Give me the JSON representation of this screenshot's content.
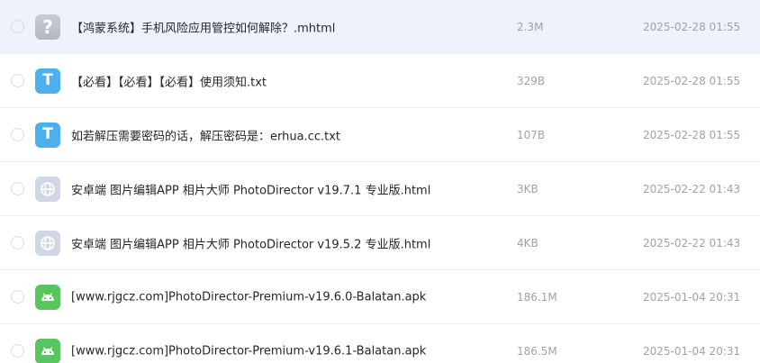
{
  "files": [
    {
      "icon": "unknown-file-icon",
      "type": "unknown",
      "glyph": "?",
      "name": "【鸿蒙系统】手机风险应用管控如何解除？.mhtml",
      "size": "2.3M",
      "date": "2025-02-28 01:55",
      "selected": true
    },
    {
      "icon": "text-file-icon",
      "type": "txt",
      "glyph": "T",
      "name": "【必看】【必看】【必看】使用须知.txt",
      "size": "329B",
      "date": "2025-02-28 01:55",
      "selected": false
    },
    {
      "icon": "text-file-icon",
      "type": "txt",
      "glyph": "T",
      "name": "如若解压需要密码的话，解压密码是：erhua.cc.txt",
      "size": "107B",
      "date": "2025-02-28 01:55",
      "selected": false
    },
    {
      "icon": "globe-icon",
      "type": "html",
      "glyph": "",
      "name": "安卓端 图片编辑APP 相片大师 PhotoDirector v19.7.1 专业版.html",
      "size": "3KB",
      "date": "2025-02-22 01:43",
      "selected": false
    },
    {
      "icon": "globe-icon",
      "type": "html",
      "glyph": "",
      "name": "安卓端 图片编辑APP 相片大师 PhotoDirector v19.5.2 专业版.html",
      "size": "4KB",
      "date": "2025-02-22 01:43",
      "selected": false
    },
    {
      "icon": "android-icon",
      "type": "apk",
      "glyph": "",
      "name": "[www.rjgcz.com]PhotoDirector-Premium-v19.6.0-Balatan.apk",
      "size": "186.1M",
      "date": "2025-01-04 20:31",
      "selected": false
    },
    {
      "icon": "android-icon",
      "type": "apk",
      "glyph": "",
      "name": "[www.rjgcz.com]PhotoDirector-Premium-v19.6.1-Balatan.apk",
      "size": "186.5M",
      "date": "2025-01-04 20:31",
      "selected": false
    }
  ],
  "colors": {
    "selected_row": "#eef2fd",
    "txt_icon": "#4cb0ec",
    "apk_icon": "#58c55f",
    "html_icon": "#d0d6e4",
    "unknown_icon": "#bfc3ce"
  }
}
